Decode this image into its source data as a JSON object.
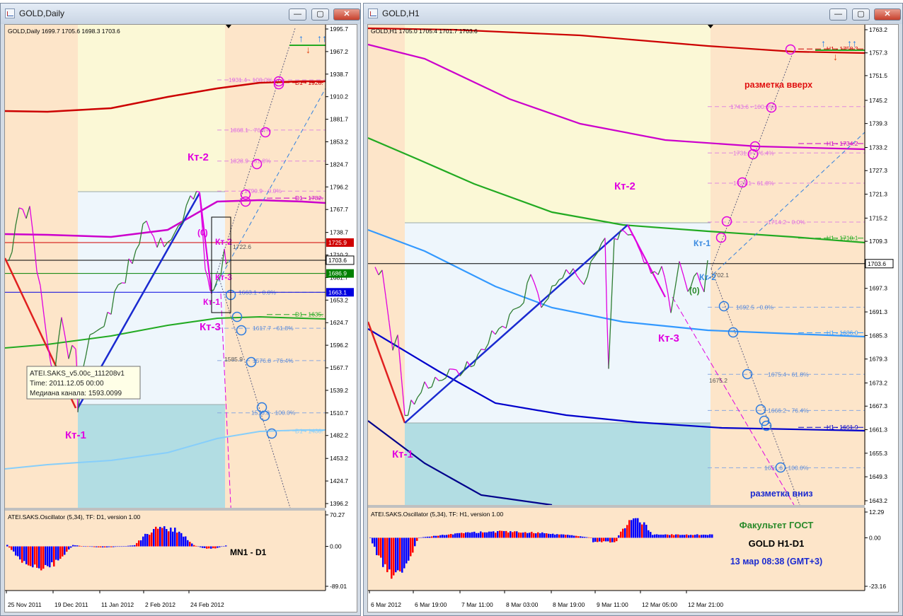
{
  "windows": [
    {
      "title": "GOLD,Daily",
      "buttons": {
        "minimize": "—",
        "maximize": "▢",
        "close": "✕"
      },
      "chart_data": {
        "type": "line",
        "symbol_header": "GOLD,Daily  1699.7 1705.6 1698.3 1703.6",
        "price_axis_ticks": [
          "1995.7",
          "1967.2",
          "1938.7",
          "1910.2",
          "1881.7",
          "1853.2",
          "1824.7",
          "1796.2",
          "1767.7",
          "1738.7",
          "1710.2",
          "1681.7",
          "1653.2",
          "1624.7",
          "1596.2",
          "1567.7",
          "1539.2",
          "1510.7",
          "1482.2",
          "1453.2",
          "1424.7",
          "1396.2"
        ],
        "price_range": [
          1396.2,
          1995.7
        ],
        "price_labels": [
          {
            "text": "1725.9",
            "value": 1725.9,
            "color": "#d00000"
          },
          {
            "text": "1703.6",
            "value": 1703.6,
            "color": "#000000"
          },
          {
            "text": "1686.9",
            "value": 1686.9,
            "color": "#008000"
          },
          {
            "text": "1663.1",
            "value": 1663.1,
            "color": "#0000e0"
          }
        ],
        "time_axis_ticks": [
          "25 Nov 2011",
          "19 Dec 2011",
          "11 Jan 2012",
          "2 Feb 2012",
          "24 Feb 2012"
        ],
        "waves": {
          "kt1": "Кт-1",
          "kt2": "Кт-2",
          "kt3": "Кт-3",
          "zero": "(0)"
        },
        "fib_levels": [
          {
            "text": "1931.4 - 100.0%",
            "value": 1931.4
          },
          {
            "text": "1868.1 - 76.4%",
            "value": 1868.1
          },
          {
            "text": "1828.9 - 61.8%",
            "value": 1828.9
          },
          {
            "text": "1790.9 - 0.0%",
            "value": 1790.9
          },
          {
            "text": "1663.1 - 0.0%",
            "value": 1663.1
          },
          {
            "text": "1617.7 - 61.8%",
            "value": 1617.7
          },
          {
            "text": "1576.8 - 76.4%",
            "value": 1576.8
          },
          {
            "text": "1510.8 - 100.0%",
            "value": 1510.8
          }
        ],
        "small_labels": [
          "1722.6",
          "1585.9"
        ],
        "ma_labels": [
          {
            "text": "D1 - 1928.",
            "value": 1928,
            "color": "#cc0000"
          },
          {
            "text": "D1 - 1782.",
            "value": 1782,
            "color": "#cc00cc"
          },
          {
            "text": "D1 - 1635.",
            "value": 1635,
            "color": "#22aa22"
          },
          {
            "text": "D1 - 1488.",
            "value": 1488,
            "color": "#87cefa"
          }
        ],
        "tooltip": [
          "ATEI.SAKS_v5.00c_111208v1",
          "Time: 2011.12.05 00:00",
          "Медиана канала: 1593.0099"
        ],
        "oscillator": {
          "title": "ATEI.SAKS.Oscillator (5,34), TF: D1, version 1.00",
          "ticks": [
            "70.27",
            "0.00",
            "-89.01"
          ],
          "range": [
            -89.01,
            70.27
          ],
          "label": "MN1 - D1"
        }
      }
    },
    {
      "title": "GOLD,H1",
      "buttons": {
        "minimize": "—",
        "maximize": "▢",
        "close": "✕"
      },
      "chart_data": {
        "type": "line",
        "symbol_header": "GOLD,H1  1705.0 1705.4 1701.7 1703.6",
        "price_axis_ticks": [
          "1763.2",
          "1757.3",
          "1751.5",
          "1745.2",
          "1739.3",
          "1733.2",
          "1727.3",
          "1721.3",
          "1715.2",
          "1709.3",
          "1703.6",
          "1697.3",
          "1691.3",
          "1685.3",
          "1679.3",
          "1673.2",
          "1667.3",
          "1661.3",
          "1655.3",
          "1649.3",
          "1643.2"
        ],
        "price_range": [
          1643.2,
          1763.2
        ],
        "price_labels": [
          {
            "text": "1703.6",
            "value": 1703.6,
            "color": "#000000"
          }
        ],
        "time_axis_ticks": [
          "6 Mar 2012",
          "6 Mar 19:00",
          "7 Mar 11:00",
          "8 Mar 03:00",
          "8 Mar 19:00",
          "9 Mar 11:00",
          "12 Mar 05:00",
          "12 Mar 21:00"
        ],
        "waves": {
          "kt1": "Кт-1",
          "kt2": "Кт-2",
          "kt3": "Кт-3",
          "kt1_current": "Кт-1",
          "kt2_current": "Кт-2",
          "zero": "(0)"
        },
        "fib_levels": [
          {
            "text": "1743.6 - 100.0%",
            "value": 1743.6
          },
          {
            "text": "1731.8 - 76.4%",
            "value": 1731.8
          },
          {
            "text": "1724.1 - 61.8%",
            "value": 1724.1
          },
          {
            "text": "1714.2 - 0.0%",
            "value": 1714.2
          },
          {
            "text": "1692.5 - 0.0%",
            "value": 1692.5
          },
          {
            "text": "1675.4 - 61.8%",
            "value": 1675.4
          },
          {
            "text": "1666.2 - 76.4%",
            "value": 1666.2
          },
          {
            "text": "1651.6 - 100.0%",
            "value": 1651.6
          }
        ],
        "small_labels": [
          "1702.1",
          "1675.2"
        ],
        "ma_labels": [
          {
            "text": "H1 - 1758.3",
            "value": 1758.3,
            "color": "#cc0000"
          },
          {
            "text": "H1 - 1734.2",
            "value": 1734.2,
            "color": "#cc00cc"
          },
          {
            "text": "H1 - 1710.1",
            "value": 1710.1,
            "color": "#22aa22"
          },
          {
            "text": "H1 - 1686.0",
            "value": 1686.0,
            "color": "#3399ff"
          },
          {
            "text": "H1 - 1661.9",
            "value": 1661.9,
            "color": "#0000cc"
          }
        ],
        "annotations": {
          "up": "разметка вверх",
          "down": "разметка вниз"
        },
        "oscillator": {
          "title": "ATEI.SAKS.Oscillator (5,34), TF: H1, version 1.00",
          "ticks": [
            "12.29",
            "0.00",
            "-23.16"
          ],
          "range": [
            -23.16,
            12.29
          ]
        },
        "info": {
          "line1": "Факультет ГОСТ",
          "line2": "GOLD   H1-D1",
          "line3": "13 мар 08:38 (GMT+3)"
        }
      }
    }
  ],
  "colors": {
    "zone_peach": "#fde5c9",
    "zone_yellow": "#fbf8d6",
    "zone_lightblue": "#eef6fc",
    "zone_teal": "#b2dde3",
    "bull": "#2e7d32",
    "bear": "#e000e0",
    "osc_up": "#ff0000",
    "osc_down": "#0000ff"
  }
}
